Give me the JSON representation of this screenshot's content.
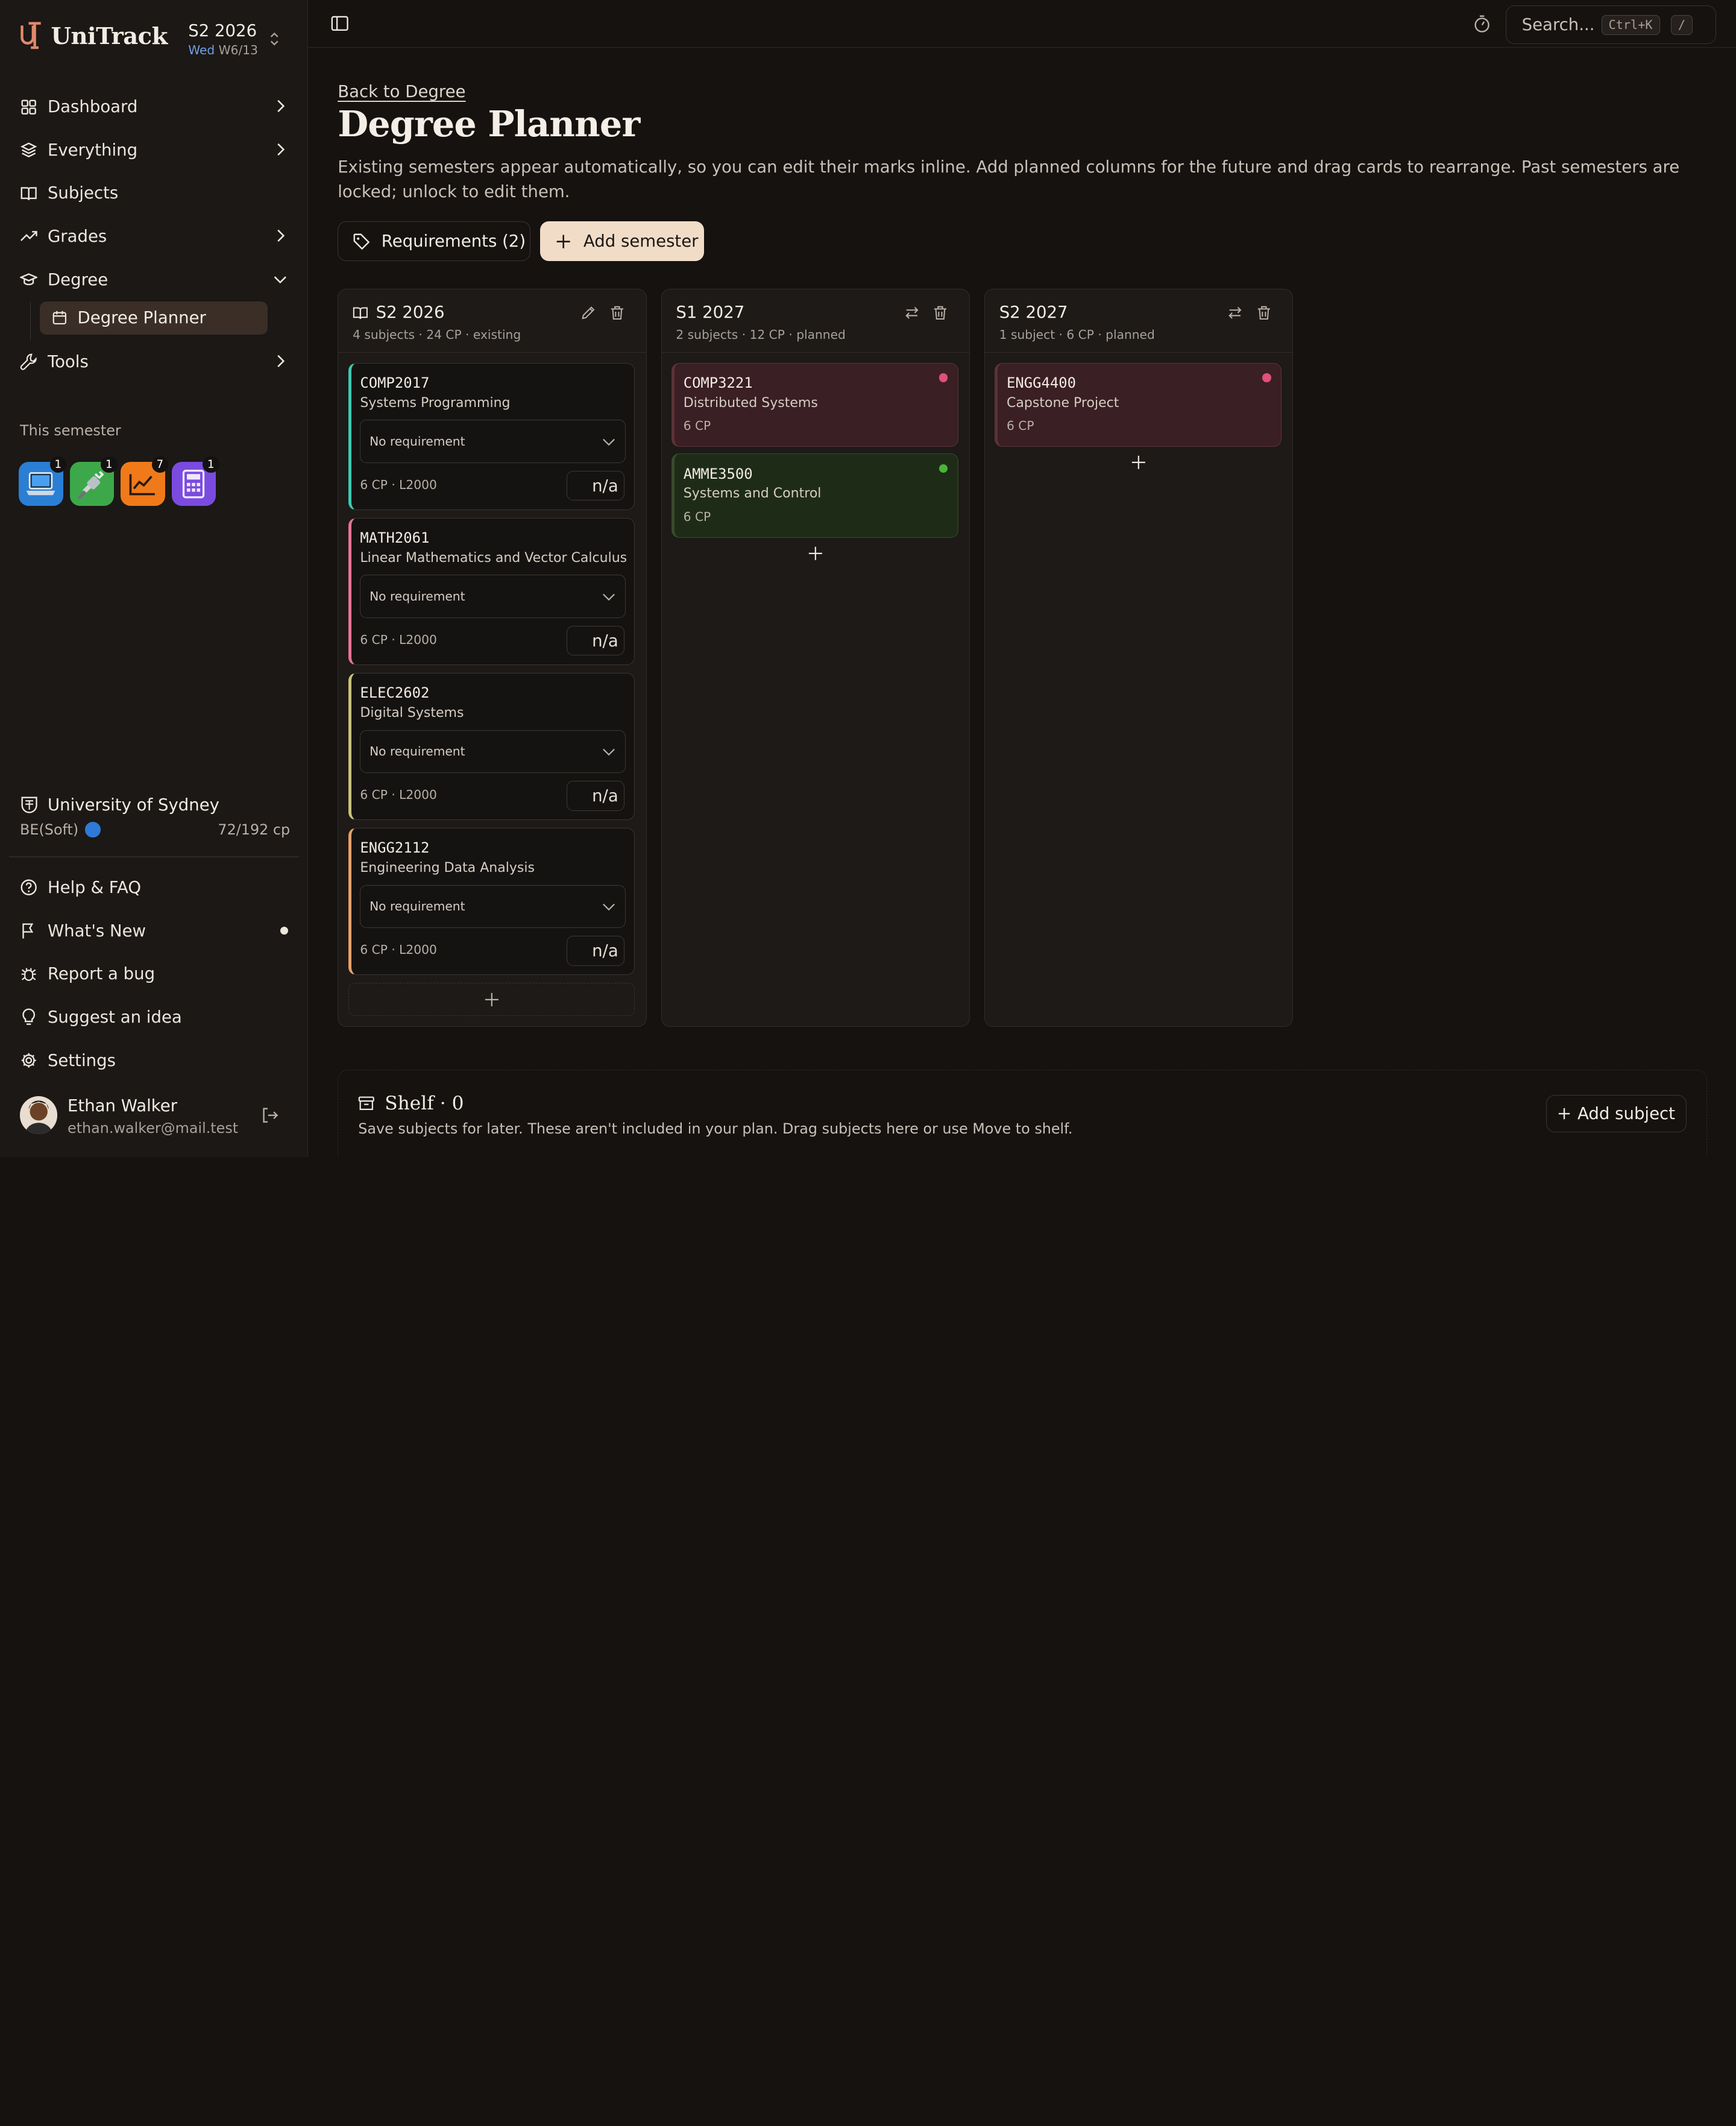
{
  "brand": {
    "name": "UniTrack"
  },
  "semester_switch": {
    "title": "S2 2026",
    "day": "Wed",
    "week": "W6/13"
  },
  "nav": [
    {
      "label": "Dashboard",
      "icon": "grid-icon",
      "chevron": "right"
    },
    {
      "label": "Everything",
      "icon": "layers-icon",
      "chevron": "right"
    },
    {
      "label": "Subjects",
      "icon": "book-icon",
      "chevron": ""
    },
    {
      "label": "Grades",
      "icon": "trend-icon",
      "chevron": "right"
    },
    {
      "label": "Degree",
      "icon": "graduation-cap-icon",
      "chevron": "down"
    }
  ],
  "nav_sub": {
    "label": "Degree Planner"
  },
  "nav_tools": {
    "label": "Tools"
  },
  "this_semester": {
    "label": "This semester",
    "apps": [
      {
        "icon": "laptop-icon",
        "badge": "1",
        "color": "#2a7fd4"
      },
      {
        "icon": "plug-icon",
        "badge": "1",
        "color": "#3da84a"
      },
      {
        "icon": "chart-line-icon",
        "badge": "7",
        "color": "#f07a1a"
      },
      {
        "icon": "calculator-icon",
        "badge": "1",
        "color": "#7b4be0"
      }
    ]
  },
  "university": {
    "name": "University of Sydney",
    "degree": "BE(Soft)",
    "progress": "72/192 cp"
  },
  "footer_nav": [
    {
      "label": "Help & FAQ"
    },
    {
      "label": "What's New"
    },
    {
      "label": "Report a bug"
    },
    {
      "label": "Suggest an idea"
    },
    {
      "label": "Settings"
    }
  ],
  "user": {
    "name": "Ethan Walker",
    "email": "ethan.walker@mail.test"
  },
  "topbar": {
    "search_placeholder": "Search...",
    "shortcut": "Ctrl+K",
    "slash": "/"
  },
  "page": {
    "back": "Back to Degree",
    "title": "Degree Planner",
    "description": "Existing semesters appear automatically, so you can edit their marks inline. Add planned columns for the future and drag cards to rearrange. Past semesters are locked; unlock to edit them.",
    "requirements_button": "Requirements (2)",
    "add_semester_button": "Add semester"
  },
  "columns": [
    {
      "title": "S2 2026",
      "meta": "4 subjects · 24 CP · existing",
      "subjects": [
        {
          "code": "COMP2017",
          "name": "Systems Programming",
          "requirement": "No requirement",
          "cp": "6 CP · L2000",
          "mark": "n/a",
          "accent": "#3ec9b0"
        },
        {
          "code": "MATH2061",
          "name": "Linear Mathematics and Vector Calculus",
          "requirement": "No requirement",
          "cp": "6 CP · L2000",
          "mark": "n/a",
          "accent": "#e8739a"
        },
        {
          "code": "ELEC2602",
          "name": "Digital Systems",
          "requirement": "No requirement",
          "cp": "6 CP · L2000",
          "mark": "n/a",
          "accent": "#c7c27a"
        },
        {
          "code": "ENGG2112",
          "name": "Engineering Data Analysis",
          "requirement": "No requirement",
          "cp": "6 CP · L2000",
          "mark": "n/a",
          "accent": "#e8a06a"
        }
      ]
    },
    {
      "title": "S1 2027",
      "meta": "2 subjects · 12 CP · planned",
      "subjects": [
        {
          "code": "COMP3221",
          "name": "Distributed Systems",
          "cp": "6 CP",
          "accent": "#e58a7a",
          "dot": "#e0507a"
        },
        {
          "code": "AMME3500",
          "name": "Systems and Control",
          "cp": "6 CP",
          "accent": "#c9b35a",
          "dot": "#4bb536"
        }
      ]
    },
    {
      "title": "S2 2027",
      "meta": "1 subject · 6 CP · planned",
      "subjects": [
        {
          "code": "ENGG4400",
          "name": "Capstone Project",
          "cp": "6 CP",
          "accent": "#e58a7a",
          "dot": "#e0507a"
        }
      ]
    }
  ],
  "shelf": {
    "title": "Shelf · 0",
    "description": "Save subjects for later. These aren't included in your plan. Drag subjects here or use Move to shelf.",
    "add_button": "Add subject"
  }
}
